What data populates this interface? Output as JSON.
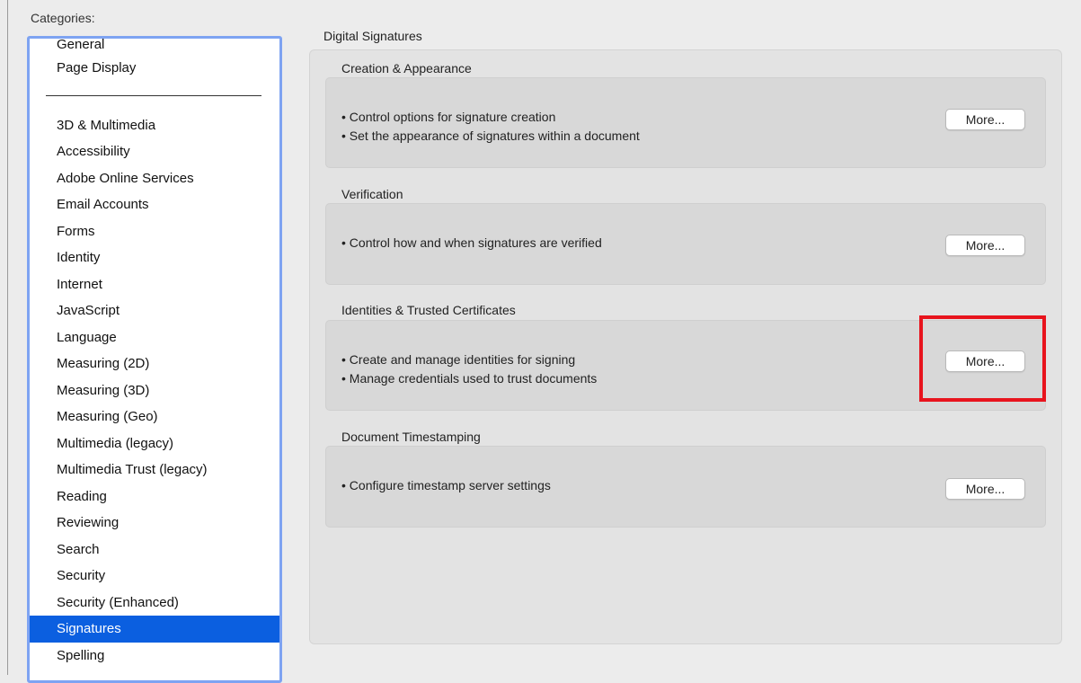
{
  "sidebar": {
    "label": "Categories:",
    "top_items": [
      "General",
      "Page Display"
    ],
    "items": [
      "3D & Multimedia",
      "Accessibility",
      "Adobe Online Services",
      "Email Accounts",
      "Forms",
      "Identity",
      "Internet",
      "JavaScript",
      "Language",
      "Measuring (2D)",
      "Measuring (3D)",
      "Measuring (Geo)",
      "Multimedia (legacy)",
      "Multimedia Trust (legacy)",
      "Reading",
      "Reviewing",
      "Search",
      "Security",
      "Security (Enhanced)",
      "Signatures",
      "Spelling"
    ],
    "selected": "Signatures"
  },
  "main": {
    "title": "Digital Signatures",
    "groups": [
      {
        "label": "Creation & Appearance",
        "lines": [
          "• Control options for signature creation",
          "• Set the appearance of signatures within a document"
        ],
        "button": "More..."
      },
      {
        "label": "Verification",
        "lines": [
          "• Control how and when signatures are verified"
        ],
        "button": "More..."
      },
      {
        "label": "Identities & Trusted Certificates",
        "lines": [
          "• Create and manage identities for signing",
          "• Manage credentials used to trust documents"
        ],
        "button": "More..."
      },
      {
        "label": "Document Timestamping",
        "lines": [
          "• Configure timestamp server settings"
        ],
        "button": "More..."
      }
    ]
  },
  "colors": {
    "selection": "#0b5fe0",
    "panel_border": "#7ea3f2",
    "highlight": "#e8141d"
  }
}
